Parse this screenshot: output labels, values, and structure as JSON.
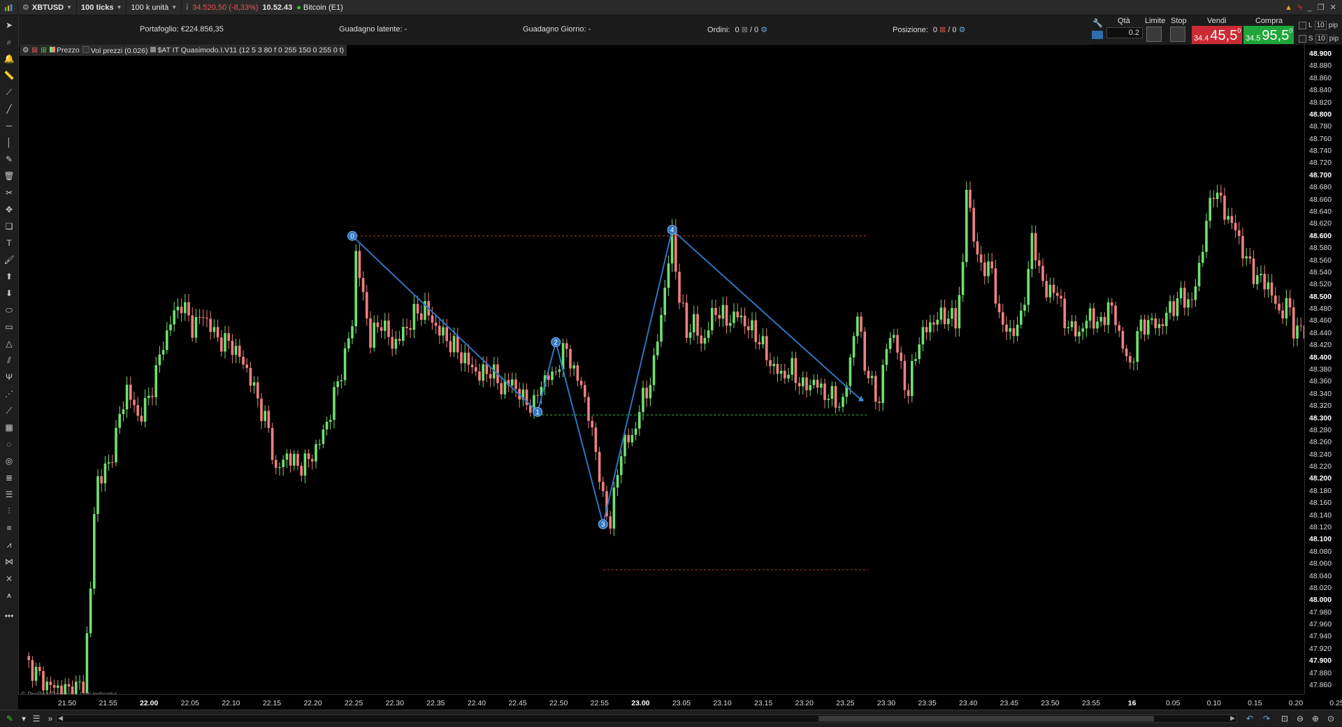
{
  "topbar": {
    "symbol": "XBTUSD",
    "timeframe": "100 ticks",
    "units": "100 k unità",
    "price_change": "34.520,50 (-8,33%)",
    "time": "10.52.43",
    "instrument": "Bitcoin (E1)"
  },
  "infobar": {
    "portfolio": "Portafoglio: €224.856,35",
    "latent_gain": "Guadagno latente: -",
    "day_gain": "Guadagno Giorno: -",
    "orders_label": "Ordini:",
    "orders_a": "0",
    "orders_b": "/ 0",
    "position_label": "Posizione:",
    "position_a": "0",
    "position_b": "/ 0"
  },
  "trade": {
    "qty_label": "Qtà",
    "qty_value": "0.2",
    "limit_label": "Limite",
    "stop_label": "Stop",
    "sell_label": "Vendi",
    "buy_label": "Compra",
    "sell_small": "34.4",
    "sell_big": "45,5",
    "sell_sup": "0",
    "buy_small": "34.5",
    "buy_big": "95,5",
    "buy_sup": "0",
    "L": "L",
    "S": "S",
    "pip1": "10",
    "pip2": "10",
    "pip_label": "pip"
  },
  "legend": {
    "price": "Prezzo",
    "volume": "Vol prezzi (0.026)",
    "indicator": "$AT IT Quasimodo.I.V11 (12 5 3 80 f 0 255 150 0 255 0 t)"
  },
  "watermark": "© ProRealTime.com  Dati indicativi",
  "colors": {
    "up": "#6fe06f",
    "down": "#f08080",
    "pattern": "#2f74c0",
    "bg": "#000000"
  },
  "chart_data": {
    "type": "candlestick",
    "ylim": [
      47.845,
      48.915
    ],
    "y_ticks": [
      "48.900",
      "48.880",
      "48.860",
      "48.840",
      "48.820",
      "48.800",
      "48.780",
      "48.760",
      "48.740",
      "48.720",
      "48.700",
      "48.680",
      "48.660",
      "48.640",
      "48.620",
      "48.600",
      "48.580",
      "48.560",
      "48.540",
      "48.520",
      "48.500",
      "48.480",
      "48.460",
      "48.440",
      "48.420",
      "48.400",
      "48.380",
      "48.360",
      "48.340",
      "48.320",
      "48.300",
      "48.280",
      "48.260",
      "48.240",
      "48.220",
      "48.200",
      "48.180",
      "48.160",
      "48.140",
      "48.120",
      "48.100",
      "48.080",
      "48.060",
      "48.040",
      "48.020",
      "48.000",
      "47.980",
      "47.960",
      "47.940",
      "47.920",
      "47.900",
      "47.880",
      "47.860"
    ],
    "y_bold_ticks": [
      "48.900",
      "48.800",
      "48.700",
      "48.600",
      "48.500",
      "48.400",
      "48.300",
      "48.200",
      "48.100",
      "48.000",
      "47.900"
    ],
    "x_ticks": [
      "21.50",
      "21.55",
      "22.00",
      "22.05",
      "22.10",
      "22.15",
      "22.20",
      "22.25",
      "22.30",
      "22.35",
      "22.40",
      "22.45",
      "22.50",
      "22.55",
      "23.00",
      "23.05",
      "23.10",
      "23.15",
      "23.20",
      "23.25",
      "23.30",
      "23.35",
      "23.40",
      "23.45",
      "23.50",
      "23.55",
      "16",
      "0.05",
      "0.10",
      "0.15",
      "0.20",
      "0.25"
    ],
    "x_bold_ticks": [
      "22.00",
      "23.00",
      "16"
    ],
    "close_path": [
      [
        0,
        47.9
      ],
      [
        6,
        47.86
      ],
      [
        12,
        47.85
      ],
      [
        16,
        47.86
      ],
      [
        18,
        48.02
      ],
      [
        19,
        48.14
      ],
      [
        20,
        48.2
      ],
      [
        23,
        48.22
      ],
      [
        26,
        48.3
      ],
      [
        28,
        48.35
      ],
      [
        31,
        48.3
      ],
      [
        34,
        48.33
      ],
      [
        37,
        48.4
      ],
      [
        40,
        48.46
      ],
      [
        43,
        48.49
      ],
      [
        46,
        48.45
      ],
      [
        49,
        48.47
      ],
      [
        53,
        48.43
      ],
      [
        57,
        48.42
      ],
      [
        61,
        48.38
      ],
      [
        64,
        48.33
      ],
      [
        67,
        48.28
      ],
      [
        69,
        48.21
      ],
      [
        72,
        48.24
      ],
      [
        75,
        48.22
      ],
      [
        78,
        48.23
      ],
      [
        81,
        48.26
      ],
      [
        84,
        48.31
      ],
      [
        86,
        48.36
      ],
      [
        88,
        48.4
      ],
      [
        90,
        48.46
      ],
      [
        91,
        48.57
      ],
      [
        93,
        48.5
      ],
      [
        95,
        48.43
      ],
      [
        98,
        48.46
      ],
      [
        101,
        48.42
      ],
      [
        104,
        48.44
      ],
      [
        107,
        48.47
      ],
      [
        110,
        48.48
      ],
      [
        113,
        48.45
      ],
      [
        116,
        48.43
      ],
      [
        119,
        48.41
      ],
      [
        122,
        48.39
      ],
      [
        125,
        48.37
      ],
      [
        128,
        48.38
      ],
      [
        131,
        48.35
      ],
      [
        134,
        48.36
      ],
      [
        137,
        48.33
      ],
      [
        140,
        48.32
      ],
      [
        142,
        48.36
      ],
      [
        145,
        48.37
      ],
      [
        147,
        48.39
      ],
      [
        149,
        48.42
      ],
      [
        151,
        48.37
      ],
      [
        153,
        48.36
      ],
      [
        155,
        48.3
      ],
      [
        157,
        48.25
      ],
      [
        159,
        48.16
      ],
      [
        161,
        48.13
      ],
      [
        163,
        48.21
      ],
      [
        165,
        48.27
      ],
      [
        167,
        48.26
      ],
      [
        169,
        48.32
      ],
      [
        171,
        48.34
      ],
      [
        173,
        48.39
      ],
      [
        175,
        48.47
      ],
      [
        177,
        48.56
      ],
      [
        178,
        48.6
      ],
      [
        180,
        48.5
      ],
      [
        182,
        48.44
      ],
      [
        184,
        48.46
      ],
      [
        186,
        48.42
      ],
      [
        188,
        48.45
      ],
      [
        190,
        48.48
      ],
      [
        193,
        48.46
      ],
      [
        196,
        48.47
      ],
      [
        199,
        48.45
      ],
      [
        202,
        48.43
      ],
      [
        205,
        48.39
      ],
      [
        208,
        48.37
      ],
      [
        211,
        48.38
      ],
      [
        214,
        48.35
      ],
      [
        217,
        48.36
      ],
      [
        220,
        48.34
      ],
      [
        223,
        48.33
      ],
      [
        225,
        48.32
      ],
      [
        227,
        48.4
      ],
      [
        229,
        48.47
      ],
      [
        231,
        48.39
      ],
      [
        233,
        48.35
      ],
      [
        235,
        48.33
      ],
      [
        237,
        48.42
      ],
      [
        239,
        48.44
      ],
      [
        241,
        48.38
      ],
      [
        243,
        48.34
      ],
      [
        245,
        48.41
      ],
      [
        247,
        48.44
      ],
      [
        250,
        48.46
      ],
      [
        253,
        48.47
      ],
      [
        256,
        48.46
      ],
      [
        258,
        48.55
      ],
      [
        259,
        48.68
      ],
      [
        261,
        48.6
      ],
      [
        263,
        48.54
      ],
      [
        265,
        48.56
      ],
      [
        267,
        48.5
      ],
      [
        269,
        48.45
      ],
      [
        271,
        48.44
      ],
      [
        274,
        48.46
      ],
      [
        277,
        48.59
      ],
      [
        279,
        48.55
      ],
      [
        281,
        48.5
      ],
      [
        283,
        48.52
      ],
      [
        285,
        48.48
      ],
      [
        287,
        48.45
      ],
      [
        290,
        48.44
      ],
      [
        293,
        48.47
      ],
      [
        296,
        48.45
      ],
      [
        298,
        48.49
      ],
      [
        300,
        48.46
      ],
      [
        302,
        48.42
      ],
      [
        304,
        48.38
      ],
      [
        306,
        48.44
      ],
      [
        309,
        48.46
      ],
      [
        312,
        48.45
      ],
      [
        315,
        48.48
      ],
      [
        318,
        48.5
      ],
      [
        321,
        48.49
      ],
      [
        323,
        48.55
      ],
      [
        325,
        48.62
      ],
      [
        327,
        48.68
      ],
      [
        330,
        48.64
      ],
      [
        333,
        48.61
      ],
      [
        336,
        48.56
      ],
      [
        339,
        48.53
      ],
      [
        342,
        48.52
      ],
      [
        345,
        48.47
      ],
      [
        347,
        48.49
      ],
      [
        349,
        48.45
      ],
      [
        352,
        48.44
      ]
    ],
    "pattern_points": [
      {
        "label": "0",
        "x": 90,
        "y": 48.6
      },
      {
        "label": "1",
        "x": 141,
        "y": 48.31
      },
      {
        "label": "2",
        "x": 146,
        "y": 48.425
      },
      {
        "label": "3",
        "x": 159,
        "y": 48.125
      },
      {
        "label": "4",
        "x": 178,
        "y": 48.61
      }
    ],
    "pattern_end": {
      "x": 230,
      "y": 48.33
    },
    "levels": [
      {
        "y": 48.6,
        "x0": 90,
        "x1": 232,
        "color": "red"
      },
      {
        "y": 48.305,
        "x0": 141,
        "x1": 232,
        "color": "green"
      },
      {
        "y": 48.05,
        "x0": 159,
        "x1": 232,
        "color": "red"
      }
    ]
  }
}
